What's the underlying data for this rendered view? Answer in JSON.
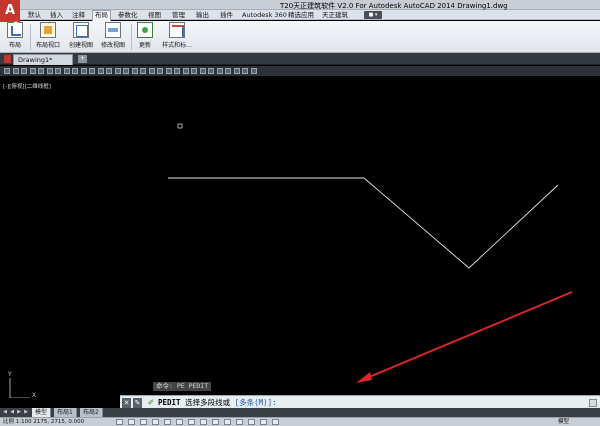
{
  "window": {
    "title": "T20天正建筑软件 V2.0 For Autodesk AutoCAD 2014    Drawing1.dwg",
    "logo": "A"
  },
  "ribbon_tabs": [
    "默认",
    "插入",
    "注释",
    "布局",
    "参数化",
    "视图",
    "管理",
    "输出",
    "插件",
    "Autodesk 360",
    "精选应用",
    "天正建筑"
  ],
  "ribbon_active_tab": "布局",
  "ribbon_buttons": [
    {
      "label": "布局",
      "icon": "layout-icon"
    },
    {
      "label": "布局视口",
      "icon": "layout-viewport-icon"
    },
    {
      "label": "创建视图",
      "icon": "create-view-icon"
    },
    {
      "label": "修改视图",
      "icon": "modify-view-icon"
    },
    {
      "label": "更新",
      "icon": "update-icon"
    },
    {
      "label": "样式和标...",
      "icon": "styles-standards-icon"
    }
  ],
  "file_tab": {
    "label": "Drawing1*"
  },
  "viewport_label": "[-][俯视][二维线框]",
  "command": {
    "history": "命令: PE PEDIT",
    "prompt_cmd": "PEDIT",
    "prompt_text": "选择多段线或",
    "prompt_option": "[多条(M)]:"
  },
  "layout_tabs": [
    {
      "label": "模型",
      "active": true
    },
    {
      "label": "布局1",
      "active": false
    },
    {
      "label": "布局2",
      "active": false
    }
  ],
  "status": {
    "coords": "比例 1:100    2175,   2715,   0.000",
    "model": "模型"
  },
  "colors": {
    "canvas": "#000000",
    "drawing_line": "#e6e6e6",
    "arrow": "#d8262a",
    "ribbon": "#e6e9ee"
  },
  "ucs_icon": {
    "x_label": "X",
    "y_label": "Y"
  }
}
